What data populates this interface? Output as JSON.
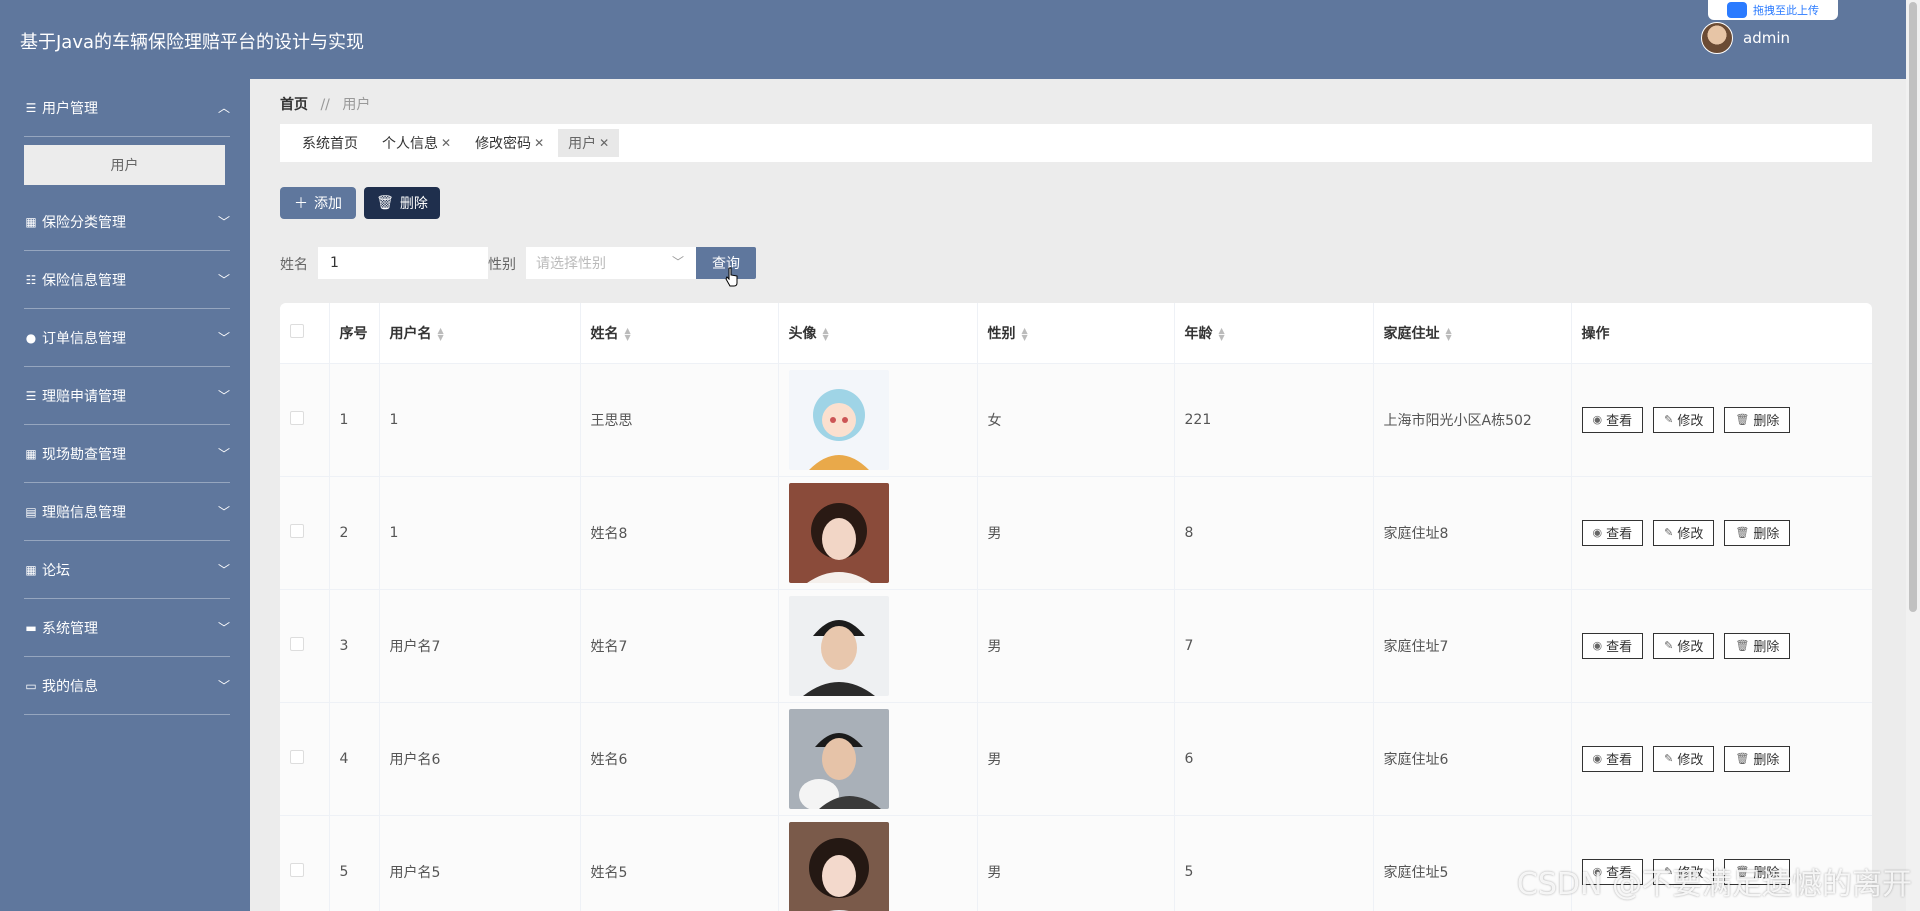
{
  "header": {
    "title": "基于Java的车辆保险理赔平台的设计与实现",
    "username": "admin",
    "upload_badge": "拖拽至此上传"
  },
  "sidebar": {
    "groups": [
      {
        "label": "用户管理",
        "icon": "menu-icon",
        "expanded": true
      },
      {
        "label": "保险分类管理",
        "icon": "grid-icon"
      },
      {
        "label": "保险信息管理",
        "icon": "sliders-icon"
      },
      {
        "label": "订单信息管理",
        "icon": "person-icon"
      },
      {
        "label": "理赔申请管理",
        "icon": "menu-icon"
      },
      {
        "label": "现场勘查管理",
        "icon": "grid-icon"
      },
      {
        "label": "理赔信息管理",
        "icon": "clipboard-icon"
      },
      {
        "label": "论坛",
        "icon": "grid-icon"
      },
      {
        "label": "系统管理",
        "icon": "monitor-icon"
      },
      {
        "label": "我的信息",
        "icon": "card-icon"
      }
    ],
    "submenu_item": "用户"
  },
  "breadcrumb": {
    "home": "首页",
    "separator": "//",
    "current": "用户"
  },
  "tabs": [
    {
      "label": "系统首页",
      "closable": false
    },
    {
      "label": "个人信息",
      "closable": true
    },
    {
      "label": "修改密码",
      "closable": true
    },
    {
      "label": "用户",
      "closable": true,
      "active": true
    }
  ],
  "toolbar": {
    "add_label": "添加",
    "delete_label": "删除"
  },
  "search": {
    "name_label": "姓名",
    "name_value": "1",
    "gender_label": "性别",
    "gender_placeholder": "请选择性别",
    "query_label": "查询"
  },
  "table": {
    "headers": [
      "序号",
      "用户名",
      "姓名",
      "头像",
      "性别",
      "年龄",
      "家庭住址",
      "操作"
    ],
    "rows": [
      {
        "index": "1",
        "username": "1",
        "name": "王思思",
        "gender": "女",
        "age": "221",
        "address": "上海市阳光小区A栋502",
        "photo": "anime-avatar"
      },
      {
        "index": "2",
        "username": "1",
        "name": "姓名8",
        "gender": "男",
        "age": "8",
        "address": "家庭住址8",
        "photo": "portrait-girl"
      },
      {
        "index": "3",
        "username": "用户名7",
        "name": "姓名7",
        "gender": "男",
        "age": "7",
        "address": "家庭住址7",
        "photo": "portrait-boy"
      },
      {
        "index": "4",
        "username": "用户名6",
        "name": "姓名6",
        "gender": "男",
        "age": "6",
        "address": "家庭住址6",
        "photo": "portrait-boy-cat"
      },
      {
        "index": "5",
        "username": "用户名5",
        "name": "姓名5",
        "gender": "男",
        "age": "5",
        "address": "家庭住址5",
        "photo": "portrait-girl-2"
      }
    ],
    "actions": {
      "view": "查看",
      "edit": "修改",
      "delete": "删除"
    }
  },
  "watermark": "CSDN @不要满足遗憾的离开"
}
